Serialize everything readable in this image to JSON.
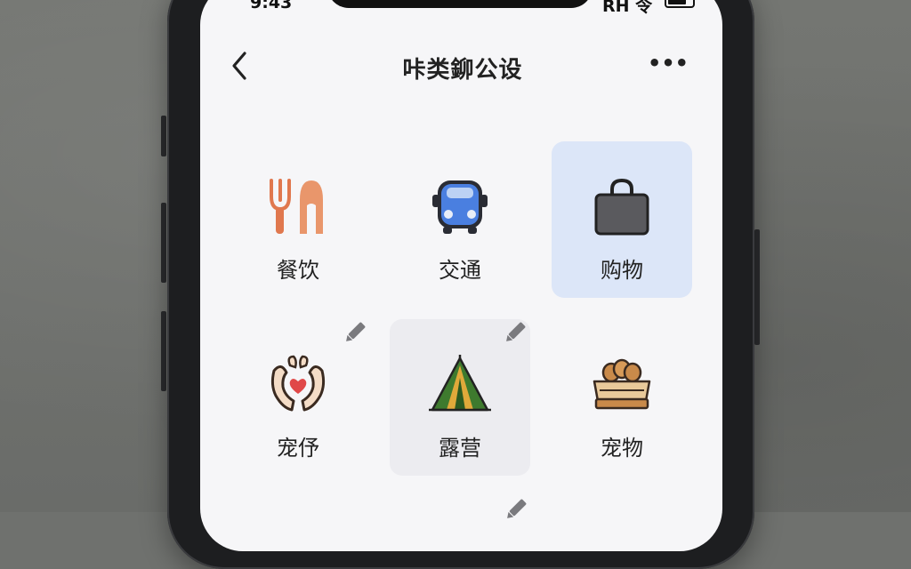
{
  "status_bar": {
    "time": "9:43",
    "signal_text": "RH 令"
  },
  "header": {
    "title": "咔类鉚公设",
    "more_label": "•••"
  },
  "categories": [
    {
      "label": "餐饮",
      "icon": "fork-spoon-icon",
      "state": "normal"
    },
    {
      "label": "交通",
      "icon": "car-icon",
      "state": "normal"
    },
    {
      "label": "购物",
      "icon": "shopping-bag-icon",
      "state": "selected"
    },
    {
      "label": "宠伃",
      "icon": "caring-hands-icon",
      "state": "editable"
    },
    {
      "label": "露营",
      "icon": "tent-icon",
      "state": "editable-highlighted"
    },
    {
      "label": "宠物",
      "icon": "pet-basket-icon",
      "state": "normal"
    }
  ],
  "colors": {
    "selected_tile": "#dce6f8",
    "highlighted_tile": "#ececf0",
    "pencil_icon": "#7a7a7e",
    "fork_icon": "#e0784e",
    "car_icon": "#4a7fe0",
    "bag_icon": "#5a5a5e",
    "tent_icon": "#3e7a2e"
  }
}
